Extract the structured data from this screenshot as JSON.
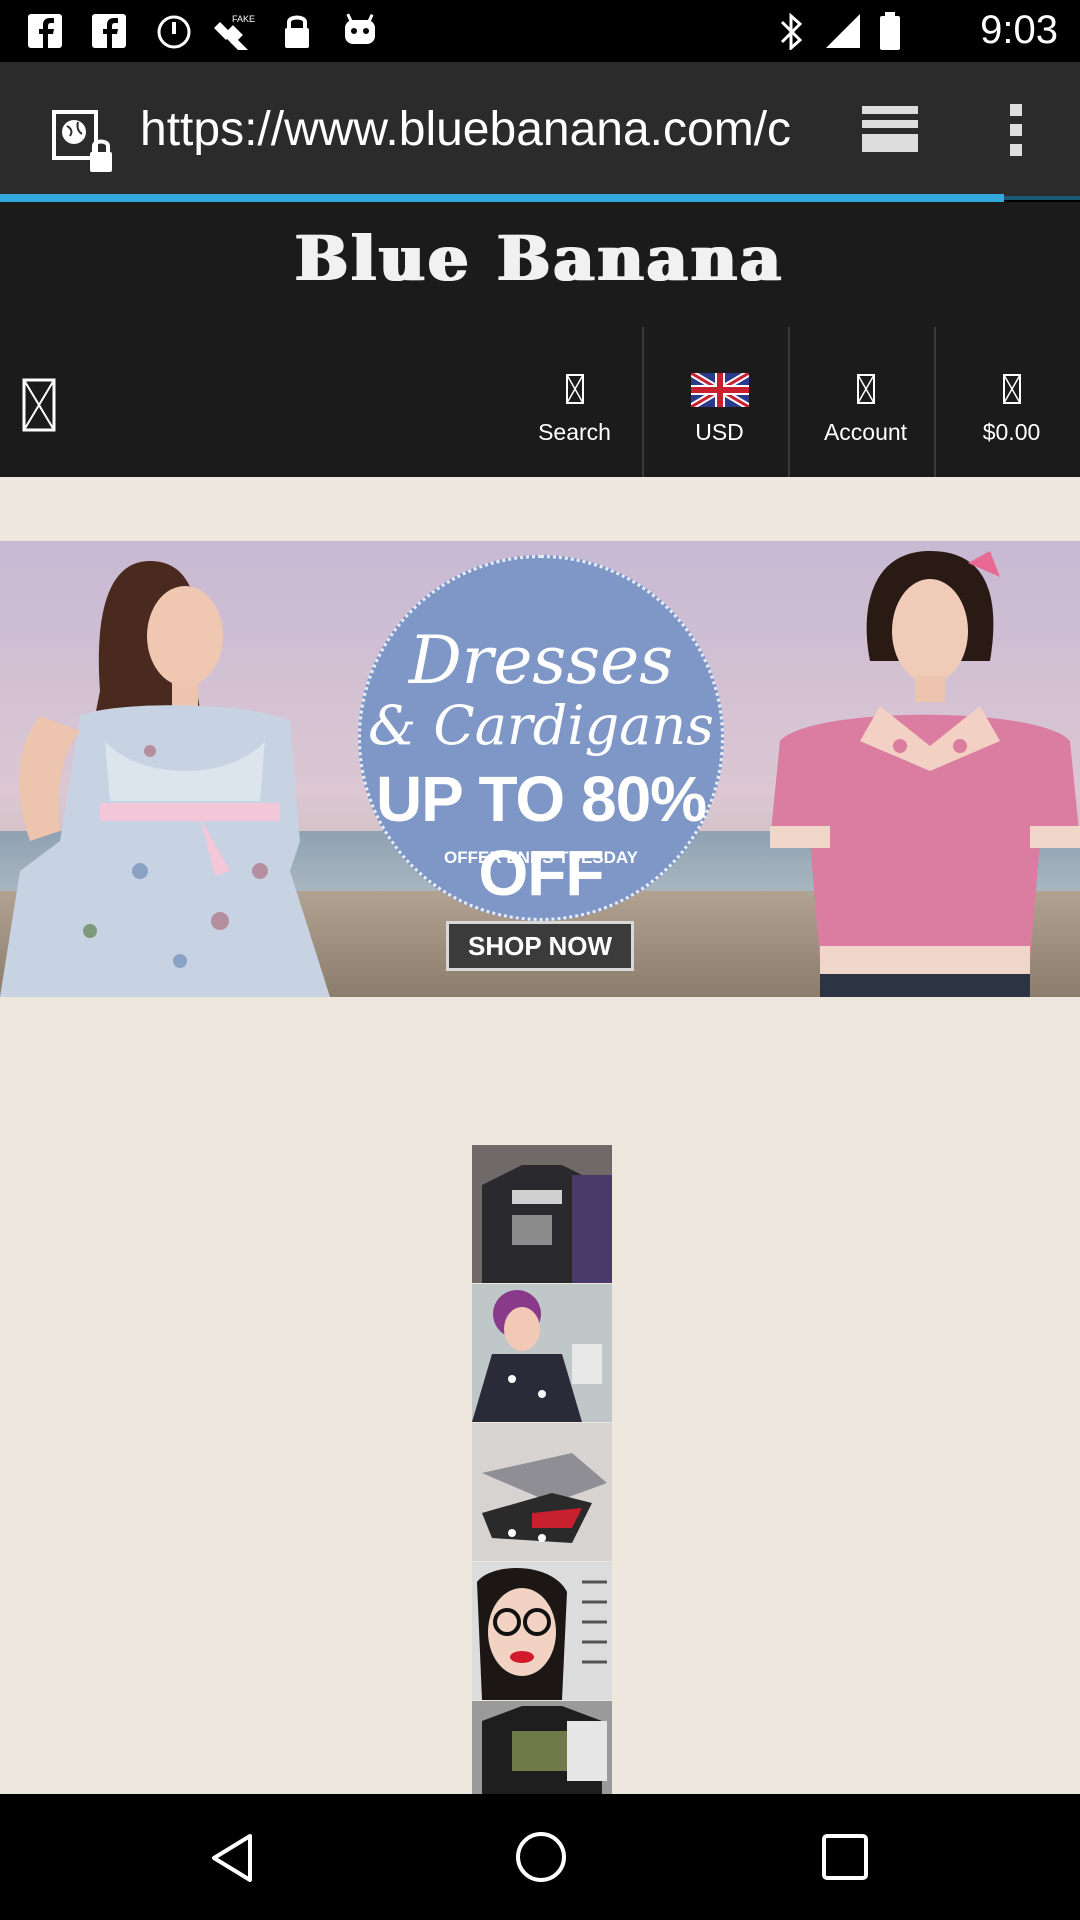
{
  "status_bar": {
    "time": "9:03",
    "left_icons": [
      "facebook-icon",
      "facebook-icon",
      "alarm-icon",
      "fake-gps-icon",
      "lock-icon",
      "android-icon"
    ],
    "right_icons": [
      "bluetooth-icon",
      "signal-icon",
      "battery-icon"
    ]
  },
  "browser": {
    "url": "https://www.bluebanana.com/c",
    "progress": 0.93
  },
  "site": {
    "logo": "Blue Banana",
    "nav": [
      {
        "label": "Search",
        "icon": "search-icon"
      },
      {
        "label": "USD",
        "icon": "uk-flag-icon"
      },
      {
        "label": "Account",
        "icon": "account-icon"
      },
      {
        "label": "$0.00",
        "icon": "cart-icon"
      }
    ]
  },
  "banner": {
    "title_line1": "Dresses",
    "title_line2": "& Cardigans",
    "discount": "UP TO 80% OFF",
    "offer_note": "OFFER ENDS TUESDAY",
    "cta": "SHOP NOW"
  },
  "colors": {
    "accent": "#33a8dd",
    "header_bg": "#1b1b1b",
    "page_bg": "#eee7dd",
    "promo_circle": "#7e97c6"
  }
}
